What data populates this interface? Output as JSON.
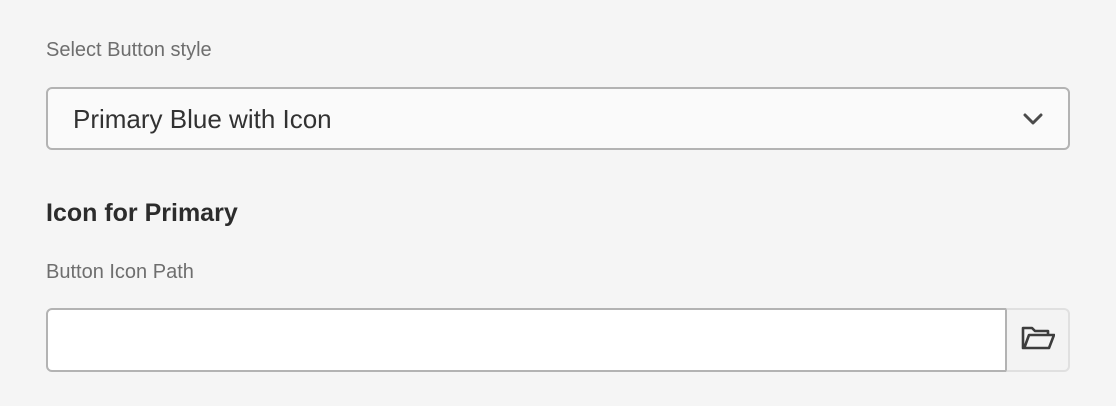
{
  "button_style": {
    "label": "Select Button style",
    "selected_value": "Primary Blue with Icon",
    "dropdown_icon": "chevron-down-icon"
  },
  "icon_section": {
    "heading": "Icon for Primary",
    "path_label": "Button Icon Path",
    "path_value": "",
    "browse_icon": "folder-open-icon"
  },
  "colors": {
    "background": "#f5f5f5",
    "border": "#b3b3b3",
    "text": "#323232",
    "label": "#6e6e6e"
  }
}
